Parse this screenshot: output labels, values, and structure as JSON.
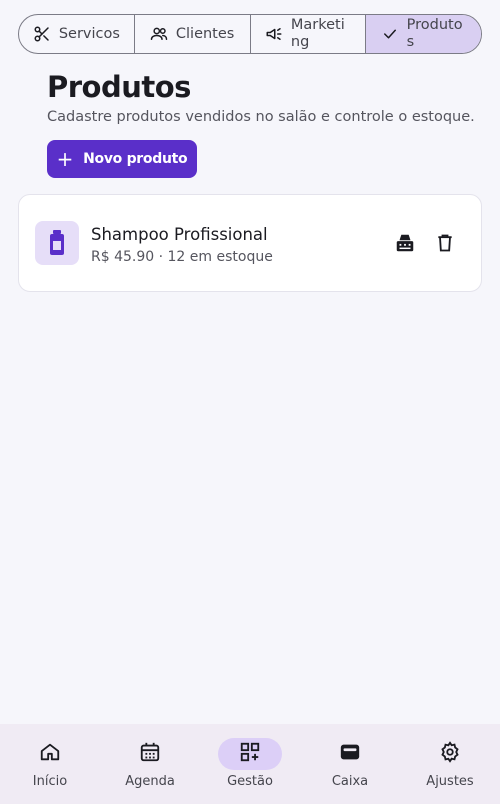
{
  "segmented": {
    "items": [
      {
        "label": "Servicos",
        "icon": "scissors-icon"
      },
      {
        "label": "Clientes",
        "icon": "people-icon"
      },
      {
        "label": "Marketing",
        "icon": "megaphone-icon"
      },
      {
        "label": "Produtos",
        "icon": "check-icon",
        "selected": true
      }
    ]
  },
  "page": {
    "title": "Produtos",
    "subtitle": "Cadastre produtos vendidos no salão e controle o estoque.",
    "new_button_label": "Novo produto"
  },
  "products": [
    {
      "name": "Shampoo Profissional",
      "meta": "R$ 45.90 · 12 em estoque",
      "icon": "bottle-icon"
    }
  ],
  "bottom_nav": {
    "items": [
      {
        "label": "Início",
        "icon": "home-icon"
      },
      {
        "label": "Agenda",
        "icon": "calendar-icon"
      },
      {
        "label": "Gestão",
        "icon": "dashboard-add-icon",
        "active": true
      },
      {
        "label": "Caixa",
        "icon": "wallet-icon"
      },
      {
        "label": "Ajustes",
        "icon": "gear-icon"
      }
    ]
  },
  "colors": {
    "primary": "#5a2fc9",
    "selected_segment": "#d9cff2",
    "nav_background": "#f0ebf4",
    "nav_active_pill": "#dccff7",
    "page_background": "#f6f6fb"
  }
}
